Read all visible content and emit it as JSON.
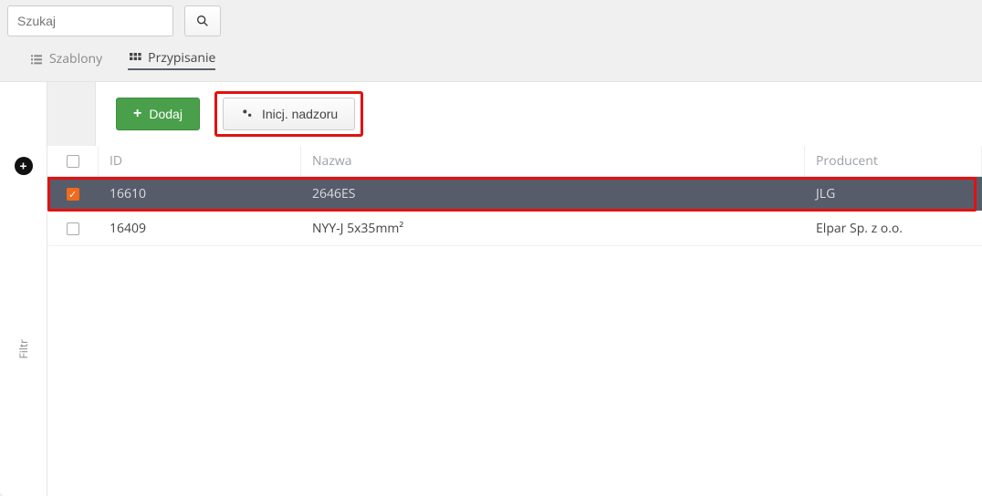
{
  "search": {
    "placeholder": "Szukaj"
  },
  "tabs": {
    "templates": "Szablony",
    "assignment": "Przypisanie"
  },
  "toolbar": {
    "add_label": "Dodaj",
    "init_label": "Inicj. nadzoru"
  },
  "sidebar": {
    "filter_label": "Filtr"
  },
  "table": {
    "headers": {
      "id": "ID",
      "name": "Nazwa",
      "producer": "Producent"
    },
    "rows": [
      {
        "id": "16610",
        "name": "2646ES",
        "producer": "JLG",
        "checked": true,
        "selected": true
      },
      {
        "id": "16409",
        "name": "NYY-J 5x35mm²",
        "producer": "Elpar Sp. z o.o.",
        "checked": false,
        "selected": false
      }
    ]
  }
}
